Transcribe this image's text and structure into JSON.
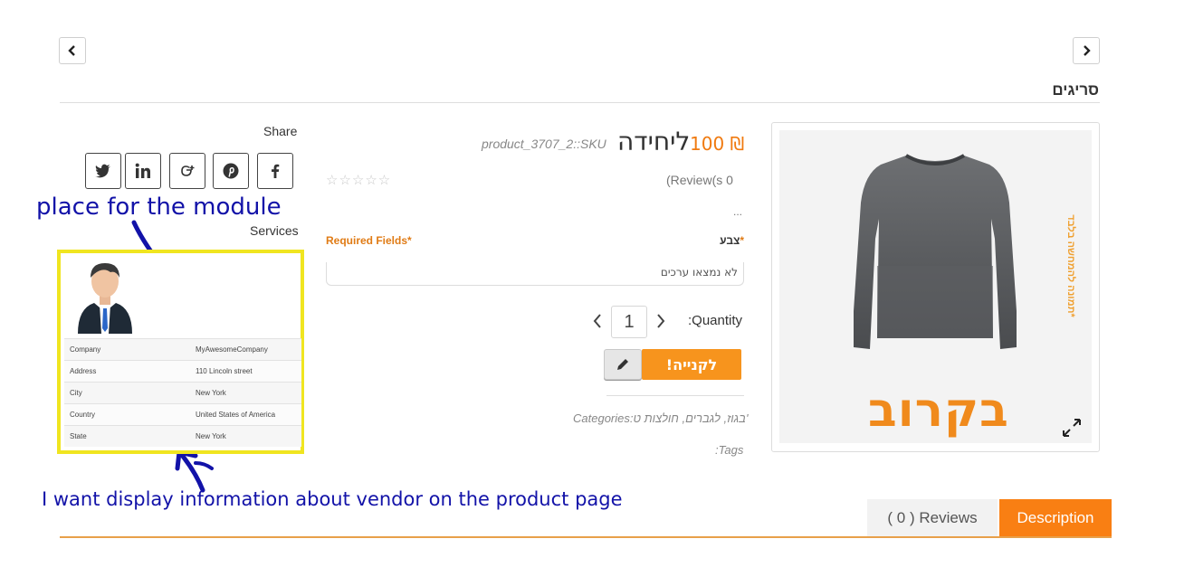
{
  "nav": {
    "prev_label": "previous",
    "next_label": "next"
  },
  "category_title": "סריגים",
  "product": {
    "price": "100 ₪",
    "title": "ליחידה",
    "sku": "product_3707_2::SKU",
    "rating_stars": "☆☆☆☆☆",
    "reviews_count": "(Review(s 0",
    "short_desc": "...",
    "required_fields": "Required Fields*",
    "color_label": "צבע",
    "color_required_mark": "*",
    "color_value": "לא נמצאו ערכים",
    "quantity_label": ":Quantity",
    "quantity_value": "1",
    "buy_label": "לקנייה!",
    "categories": "Categories:בגוז, לגברים, חולצות ט'",
    "tags": ":Tags",
    "image_text": "בקרוב",
    "image_note": "*תמונה להמחשה בלבד"
  },
  "share": {
    "label": "Share",
    "networks": [
      "twitter",
      "linkedin",
      "google-plus",
      "pinterest",
      "facebook"
    ]
  },
  "services_label": "Services",
  "annotations": {
    "module_place": "place for the module",
    "vendor_info": "I want display information about vendor on the product page"
  },
  "vendor": {
    "rows": [
      {
        "key": "Company",
        "value": "MyAwesomeCompany"
      },
      {
        "key": "Address",
        "value": "110 Lincoln street"
      },
      {
        "key": "City",
        "value": "New York"
      },
      {
        "key": "Country",
        "value": "United States of America"
      },
      {
        "key": "State",
        "value": "New York"
      }
    ]
  },
  "tabs": {
    "reviews": "( 0 ) Reviews",
    "description": "Description"
  },
  "colors": {
    "accent": "#f7941d",
    "annotation": "#1212a8",
    "highlight": "#f0e520"
  }
}
